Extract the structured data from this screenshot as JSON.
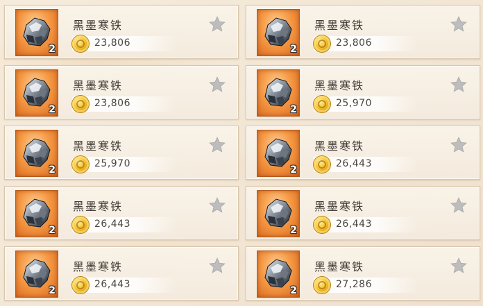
{
  "items": [
    {
      "name": "黑墨寒铁",
      "quantity": "2",
      "price": "23,806",
      "favorited": false
    },
    {
      "name": "黑墨寒铁",
      "quantity": "2",
      "price": "23,806",
      "favorited": false
    },
    {
      "name": "黑墨寒铁",
      "quantity": "2",
      "price": "23,806",
      "favorited": false
    },
    {
      "name": "黑墨寒铁",
      "quantity": "2",
      "price": "25,970",
      "favorited": false
    },
    {
      "name": "黑墨寒铁",
      "quantity": "2",
      "price": "25,970",
      "favorited": false
    },
    {
      "name": "黑墨寒铁",
      "quantity": "2",
      "price": "26,443",
      "favorited": false
    },
    {
      "name": "黑墨寒铁",
      "quantity": "2",
      "price": "26,443",
      "favorited": false
    },
    {
      "name": "黑墨寒铁",
      "quantity": "2",
      "price": "26,443",
      "favorited": false
    },
    {
      "name": "黑墨寒铁",
      "quantity": "2",
      "price": "26,443",
      "favorited": false
    },
    {
      "name": "黑墨寒铁",
      "quantity": "2",
      "price": "27,286",
      "favorited": false
    }
  ],
  "icons": {
    "item": "ore-icon",
    "currency": "coin-icon",
    "favorite": "star-icon"
  },
  "colors": {
    "icon_frame": "#f59a45",
    "star_inactive": "#bdbdbd",
    "text": "#3f3a35"
  }
}
